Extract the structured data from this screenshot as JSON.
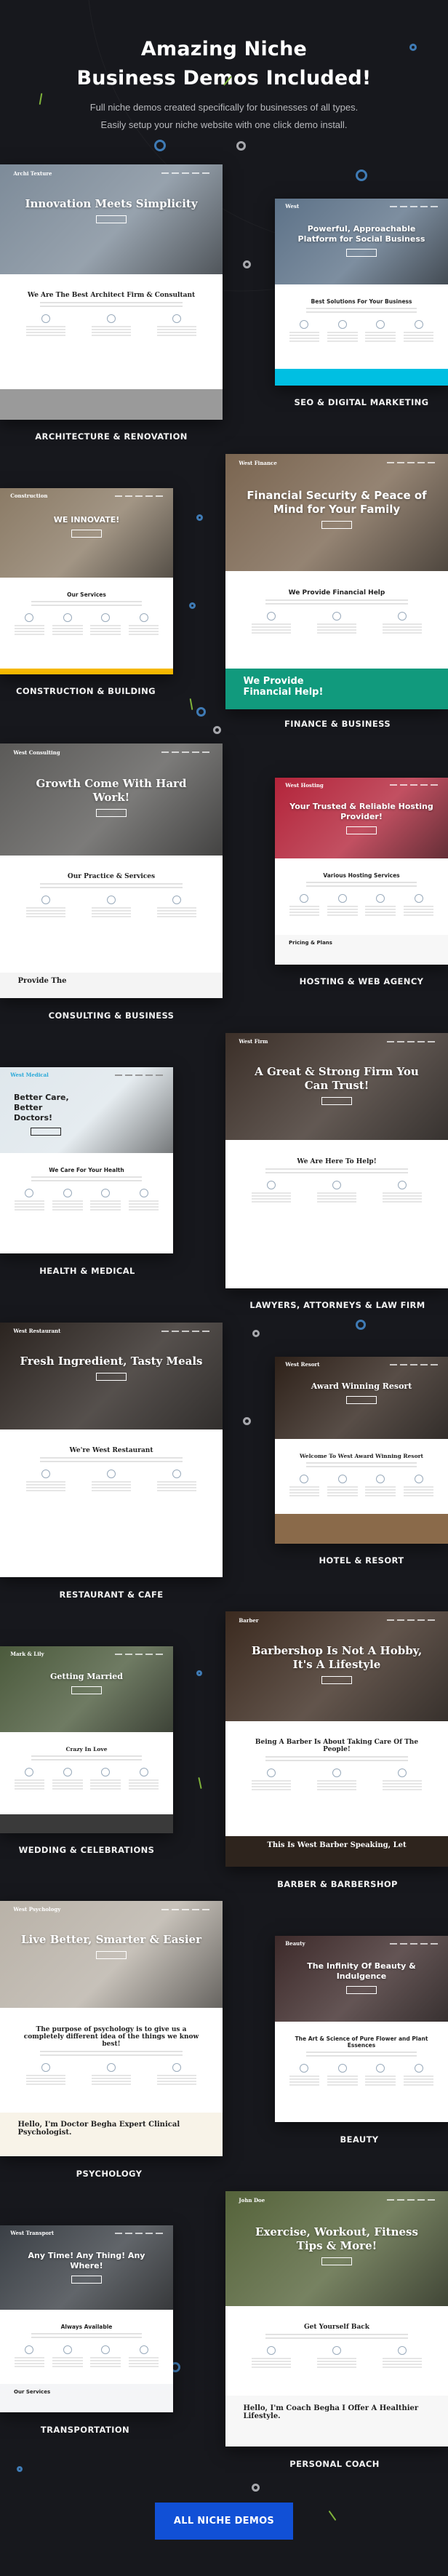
{
  "header": {
    "title_line1": "Amazing Niche",
    "title_line2": "Business Demos Included!",
    "subtitle_line1": "Full niche demos created specifically for businesses of all types.",
    "subtitle_line2": "Easily setup your niche website with one click demo install."
  },
  "demos": [
    {
      "label": "ARCHITECTURE & RENOVATION",
      "logo": "Archi Texture",
      "hero": "Innovation Meets Simplicity",
      "section": "We Are The Best Architect Firm & Consultant",
      "band": "",
      "hero_color": "#7d8b99",
      "band_color": "#9a9a9a"
    },
    {
      "label": "SEO & DIGITAL MARKETING",
      "logo": "West",
      "hero": "Powerful, Approachable Platform for Social Business",
      "section": "Best Solutions For Your Business",
      "band": "",
      "hero_color": "#5d7288",
      "band_color": "#00bfe2"
    },
    {
      "label": "CONSTRUCTION & BUILDING",
      "logo": "Construction",
      "hero": "WE INNOVATE!",
      "section": "Our Services",
      "band": "",
      "hero_color": "#8b7b66",
      "band_color": "#f5b800"
    },
    {
      "label": "FINANCE & BUSINESS",
      "logo": "West Finance",
      "hero": "Financial Security & Peace of Mind for Your Family",
      "section": "We Provide Financial Help",
      "band": "We Provide Financial Help!",
      "hero_color": "#7a6550",
      "band_color": "#119a7d"
    },
    {
      "label": "CONSULTING & BUSINESS",
      "logo": "West Consulting",
      "hero": "Growth Come With Hard Work!",
      "section": "Our Practice & Services",
      "band": "Provide The",
      "hero_color": "#5b5a58",
      "band_color": "#f4f4f4"
    },
    {
      "label": "HOSTING & WEB AGENCY",
      "logo": "West Hosting",
      "hero": "Your Trusted & Reliable Hosting Provider!",
      "section": "Various Hosting Services",
      "band": "Pricing & Plans",
      "hero_color": "#b3243a",
      "band_color": "#f7f7f7"
    },
    {
      "label": "HEALTH & MEDICAL",
      "logo": "West Medical",
      "hero": "Better Care, Better Doctors!",
      "section": "We Care For Your Health",
      "band": "",
      "hero_color": "#dfe7ec",
      "band_color": "#2fbfe0"
    },
    {
      "label": "LAWYERS, ATTORNEYS & LAW FIRM",
      "logo": "West Firm",
      "hero": "A Great & Strong Firm You Can Trust!",
      "section": "We Are Here To Help!",
      "band": "",
      "hero_color": "#3b2f28",
      "band_color": "#ffffff"
    },
    {
      "label": "RESTAURANT & CAFE",
      "logo": "West Restaurant",
      "hero": "Fresh Ingredient, Tasty Meals",
      "section": "We're West Restaurant",
      "band": "",
      "hero_color": "#2b2420",
      "band_color": "#ffffff"
    },
    {
      "label": "HOTEL & RESORT",
      "logo": "West Resort",
      "hero": "Award Winning Resort",
      "section": "Welcome To West Award Winning Resort",
      "band": "",
      "hero_color": "#2e2119",
      "band_color": "#8a6a4a"
    },
    {
      "label": "WEDDING & CELEBRATIONS",
      "logo": "Mark & Lily",
      "hero": "Getting Married",
      "section": "Crazy In Love",
      "band": "",
      "hero_color": "#4b5a3c",
      "band_color": "#3a3a3a"
    },
    {
      "label": "BARBER & BARBERSHOP",
      "logo": "Barber",
      "hero": "Barbershop Is Not A Hobby, It's A Lifestyle",
      "section": "Being A Barber Is About Taking Care Of The People!",
      "band": "This Is West Barber Speaking, Let",
      "hero_color": "#3b2a1f",
      "band_color": "#2e241d"
    },
    {
      "label": "PSYCHOLOGY",
      "logo": "West Psychology",
      "hero": "Live Better, Smarter & Easier",
      "section": "The purpose of psychology is to give us a completely different idea of the things we know best!",
      "band": "Hello, I'm Doctor Begha Expert Clinical Psychologist.",
      "hero_color": "#b9b2a8",
      "band_color": "#f8f3e8"
    },
    {
      "label": "BEAUTY",
      "logo": "Beauty",
      "hero": "The Infinity Of Beauty & Indulgence",
      "section": "The Art & Science of Pure Flower and Plant Essences",
      "band": "",
      "hero_color": "#3d2a2a",
      "band_color": "#ffffff"
    },
    {
      "label": "TRANSPORTATION",
      "logo": "West Transport",
      "hero": "Any Time! Any Thing! Any Where!",
      "section": "Always Available",
      "band": "Our Services",
      "hero_color": "#3a3f45",
      "band_color": "#f4f5f7"
    },
    {
      "label": "PERSONAL COACH",
      "logo": "John Doe",
      "hero": "Exercise, Workout, Fitness Tips & More!",
      "section": "Get Yourself Back",
      "band": "Hello, I'm Coach Begha I Offer A Healthier Lifestyle.",
      "hero_color": "#55633a",
      "band_color": "#f7f7f7"
    }
  ],
  "cta": {
    "label": "ALL NICHE DEMOS",
    "color": "#1150d6"
  },
  "colors": {
    "background": "#17181d",
    "ring_blue": "#3f7bb5",
    "ring_grey": "#a7a8ad",
    "dash_green": "#7fb33a"
  }
}
